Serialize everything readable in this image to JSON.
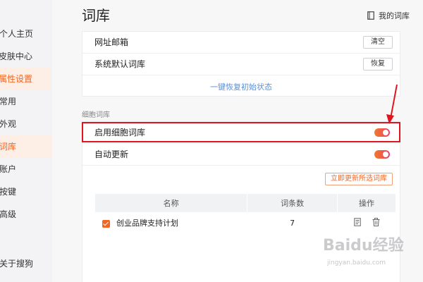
{
  "sidebar": {
    "items": [
      {
        "label": "个人主页"
      },
      {
        "label": "皮肤中心"
      },
      {
        "label": "属性设置"
      },
      {
        "label": "常用"
      },
      {
        "label": "外观"
      },
      {
        "label": "词库"
      },
      {
        "label": "账户"
      },
      {
        "label": "按键"
      },
      {
        "label": "高级"
      },
      {
        "label": "关于搜狗"
      }
    ],
    "active_items": [
      "属性设置",
      "词库"
    ],
    "active_color": "#f26522"
  },
  "header": {
    "title": "词库",
    "my_library_label": "我的词库",
    "my_library_icon": "book-icon"
  },
  "settings_card": {
    "rows": [
      {
        "label": "网址邮箱",
        "button_label": "清空"
      },
      {
        "label": "系统默认词库",
        "button_label": "恢复"
      }
    ],
    "restore_all_label": "一键恢复初始状态"
  },
  "cell_section": {
    "section_label": "细胞词库",
    "enable_label": "启用细胞词库",
    "enable_on": true,
    "auto_update_label": "自动更新",
    "auto_update_on": true,
    "update_selected_label": "立即更新所选词库",
    "table": {
      "headers": [
        "名称",
        "词条数",
        "操作"
      ],
      "rows": [
        {
          "checked": true,
          "name": "创业品牌支持计划",
          "count": "7",
          "actions": [
            "document-icon",
            "trash-icon"
          ]
        }
      ]
    }
  },
  "watermark": {
    "text": "Baidu经验",
    "sub": "jingyan.baidu.com"
  },
  "colors": {
    "accent": "#f26522",
    "toggle_gradient": [
      "#f07a2a",
      "#ef3f6b"
    ],
    "annotation_red": "#e0141e",
    "link_blue": "#5b8fd6"
  }
}
